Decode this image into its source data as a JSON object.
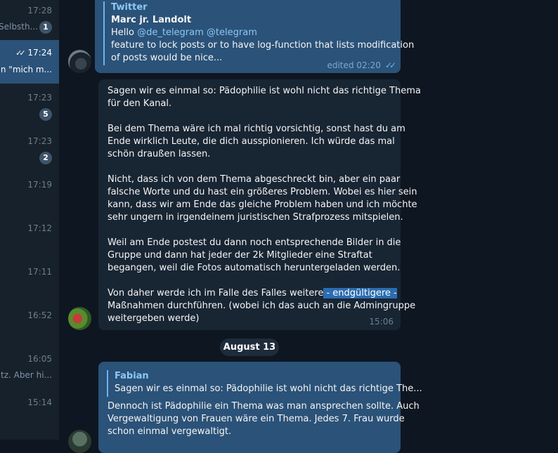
{
  "sidebar": {
    "rows": [
      {
        "time": "17:28",
        "preview": "Selbsth...",
        "unread": "1",
        "active": false
      },
      {
        "time": "17:24",
        "preview": "in \"mich m...",
        "unread": "",
        "active": true
      },
      {
        "time": "17:23",
        "preview": "",
        "unread": "5",
        "active": false
      },
      {
        "time": "17:23",
        "preview": "",
        "unread": "2",
        "active": false
      },
      {
        "time": "17:19",
        "preview": "",
        "unread": "",
        "active": false
      },
      {
        "time": "17:12",
        "preview": "",
        "unread": "",
        "active": false
      },
      {
        "time": "17:11",
        "preview": "",
        "unread": "",
        "active": false
      },
      {
        "time": "16:52",
        "preview": "",
        "unread": "",
        "active": false
      },
      {
        "time": "16:05",
        "preview": "atz. Aber hi...",
        "unread": "",
        "active": false
      },
      {
        "time": "15:14",
        "preview": "",
        "unread": "",
        "active": false
      }
    ]
  },
  "messages": {
    "msg1": {
      "reply_name": "Twitter",
      "author": "Marc jr. Landolt",
      "hello": "Hello ",
      "mention1": "@de_telegram",
      "mention2": "@telegram",
      "line3": "feature to lock posts or to have log-function that lists modification",
      "line4": "of posts would be nice...",
      "meta": "edited 02:20",
      "ticks": "✓✓"
    },
    "msg2": {
      "p1_l1": "Sagen wir es einmal so: Pädophilie ist wohl nicht das richtige Thema",
      "p1_l2": "für den Kanal.",
      "p2_l1": "Bei dem Thema wäre ich mal richtig vorsichtig, sonst hast du am",
      "p2_l2": "Ende wirklich Leute, die dich ausspionieren. Ich würde das mal",
      "p2_l3": "schön draußen lassen.",
      "p3_l1": "Nicht, dass ich von dem Thema abgeschreckt bin, aber ein paar",
      "p3_l2": "falsche Worte und du hast ein größeres Problem. Wobei es hier sein",
      "p3_l3": "kann, dass wir am Ende das gleiche Problem haben und ich möchte",
      "p3_l4": "sehr ungern in irgendeinem juristischen Strafprozess mitspielen.",
      "p4_l1": "Weil am Ende postest du dann noch entsprechende Bilder in die",
      "p4_l2": "Gruppe und dann hat jeder der 2k Mitglieder eine Straftat",
      "p4_l3": "begangen, weil die Fotos automatisch heruntergeladen werden.",
      "p5_l1a": "Von daher werde ich im Falle des Falles weitere",
      "p5_l1b": " - endgültigere - ",
      "p5_l2": "Maßnahmen durchführen. (wobei ich das auch an die Admingruppe",
      "p5_l3": "weitergeben werde)",
      "time": "15:06"
    },
    "date_separator": "August 13",
    "msg3": {
      "reply_name": "Fabian",
      "reply_text": "Sagen wir es einmal so: Pädophilie ist wohl nicht das richtige The...",
      "l1": "Dennoch ist Pädophilie ein Thema was man ansprechen sollte. Auch",
      "l2": "Vergewaltigung von Frauen wäre ein Thema. Jedes 7. Frau wurde",
      "l3": "schon einmal vergewaltigt."
    }
  }
}
